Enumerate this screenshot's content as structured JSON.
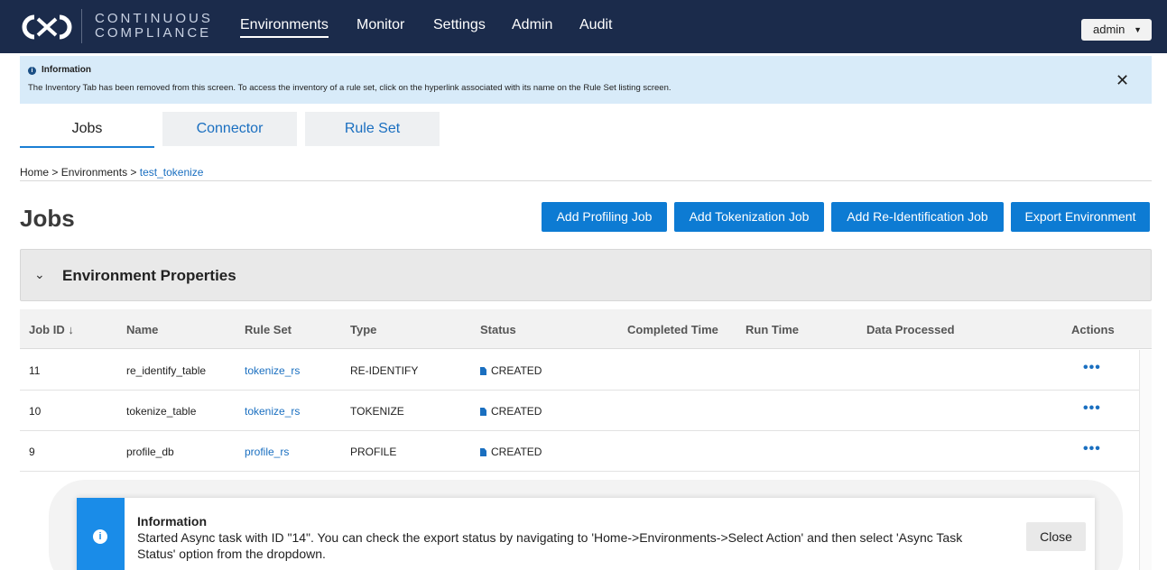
{
  "brand": {
    "line1": "CONTINUOUS",
    "line2": "COMPLIANCE"
  },
  "nav": {
    "items": [
      "Environments",
      "Monitor",
      "Settings",
      "Admin",
      "Audit"
    ],
    "active": "Environments",
    "user": "admin"
  },
  "banner": {
    "title": "Information",
    "text": "The Inventory Tab has been removed from this screen. To access the inventory of a rule set, click on the hyperlink associated with its name on the Rule Set listing screen."
  },
  "tabs": [
    "Jobs",
    "Connector",
    "Rule Set"
  ],
  "breadcrumb": {
    "home": "Home",
    "sep": " > ",
    "env": "Environments",
    "current": "test_tokenize"
  },
  "page_title": "Jobs",
  "buttons": [
    "Add Profiling Job",
    "Add Tokenization Job",
    "Add Re-Identification Job",
    "Export Environment"
  ],
  "env_props": {
    "title": "Environment Properties"
  },
  "table": {
    "headers": [
      "Job ID",
      "Name",
      "Rule Set",
      "Type",
      "Status",
      "Completed Time",
      "Run Time",
      "Data Processed",
      "Actions"
    ],
    "rows": [
      {
        "id": "11",
        "name": "re_identify_table",
        "rule_set": "tokenize_rs",
        "type": "RE-IDENTIFY",
        "status": "CREATED"
      },
      {
        "id": "10",
        "name": "tokenize_table",
        "rule_set": "tokenize_rs",
        "type": "TOKENIZE",
        "status": "CREATED"
      },
      {
        "id": "9",
        "name": "profile_db",
        "rule_set": "profile_rs",
        "type": "PROFILE",
        "status": "CREATED"
      }
    ]
  },
  "toast": {
    "title": "Information",
    "message": "Started Async task with ID \"14\". You can check the export status by navigating to 'Home->Environments->Select Action' and then select 'Async Task Status' option from the dropdown.",
    "close": "Close"
  },
  "colors": {
    "nav_bg": "#1b2b4b",
    "primary": "#0d7bd3",
    "link": "#1a6fc0",
    "banner_bg": "#d8ebf9"
  }
}
